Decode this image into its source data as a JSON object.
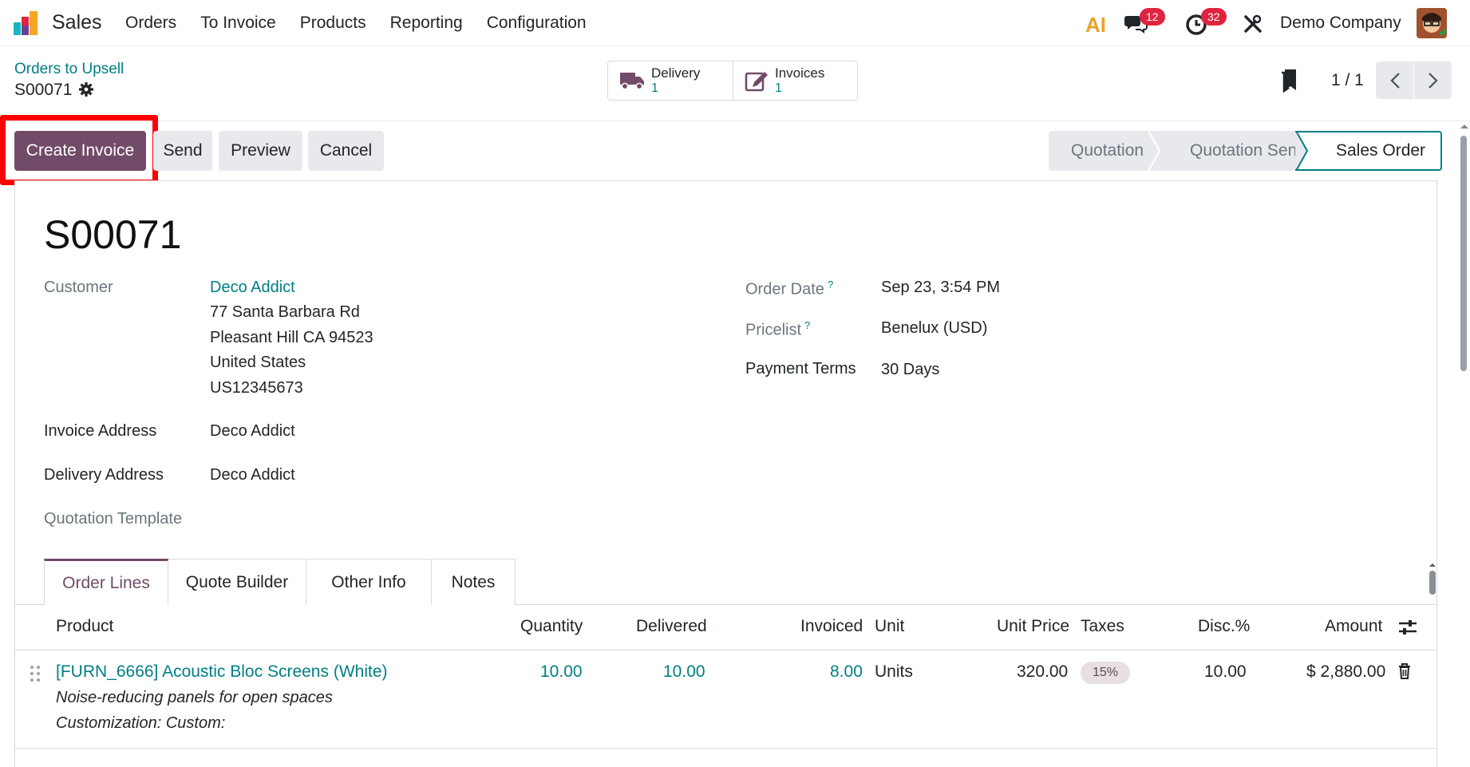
{
  "navbar": {
    "app_name": "Sales",
    "menu": [
      "Orders",
      "To Invoice",
      "Products",
      "Reporting",
      "Configuration"
    ],
    "ai_label": "AI",
    "chat_badge": "12",
    "activity_badge": "32",
    "company": "Demo Company"
  },
  "control": {
    "breadcrumb": "Orders to Upsell",
    "record": "S00071",
    "smart_buttons": [
      {
        "label": "Delivery",
        "count": "1",
        "icon": "truck-icon"
      },
      {
        "label": "Invoices",
        "count": "1",
        "icon": "edit-icon"
      }
    ],
    "pager": "1 / 1"
  },
  "actions": {
    "create_invoice": "Create Invoice",
    "send": "Send",
    "preview": "Preview",
    "cancel": "Cancel"
  },
  "status": {
    "stages": [
      "Quotation",
      "Quotation Sent",
      "Sales Order"
    ],
    "current": "Sales Order"
  },
  "form": {
    "name": "S00071",
    "customer_label": "Customer",
    "customer_name": "Deco Addict",
    "address_lines": [
      "77 Santa Barbara Rd",
      "Pleasant Hill CA 94523",
      "United States",
      "US12345673"
    ],
    "invoice_address_label": "Invoice Address",
    "invoice_address": "Deco Addict",
    "delivery_address_label": "Delivery Address",
    "delivery_address": "Deco Addict",
    "quotation_template_label": "Quotation Template",
    "order_date_label": "Order Date",
    "order_date": "Sep 23, 3:54 PM",
    "pricelist_label": "Pricelist",
    "pricelist": "Benelux (USD)",
    "payment_terms_label": "Payment Terms",
    "payment_terms": "30 Days",
    "help_mark": "?"
  },
  "tabs": [
    "Order Lines",
    "Quote Builder",
    "Other Info",
    "Notes"
  ],
  "table": {
    "columns": [
      "Product",
      "Quantity",
      "Delivered",
      "Invoiced",
      "Unit",
      "Unit Price",
      "Taxes",
      "Disc.%",
      "Amount"
    ],
    "rows": [
      {
        "product": "[FURN_6666] Acoustic Bloc Screens (White)",
        "description": "Noise-reducing panels for open spaces",
        "customization": "Customization: Custom:",
        "quantity": "10.00",
        "delivered": "10.00",
        "invoiced": "8.00",
        "unit": "Units",
        "unit_price": "320.00",
        "taxes": "15%",
        "discount": "10.00",
        "amount": "$ 2,880.00"
      }
    ]
  },
  "colors": {
    "primary": "#714b67",
    "link": "#017e84",
    "highlight": "#ff0000",
    "badge": "#e0233e"
  }
}
